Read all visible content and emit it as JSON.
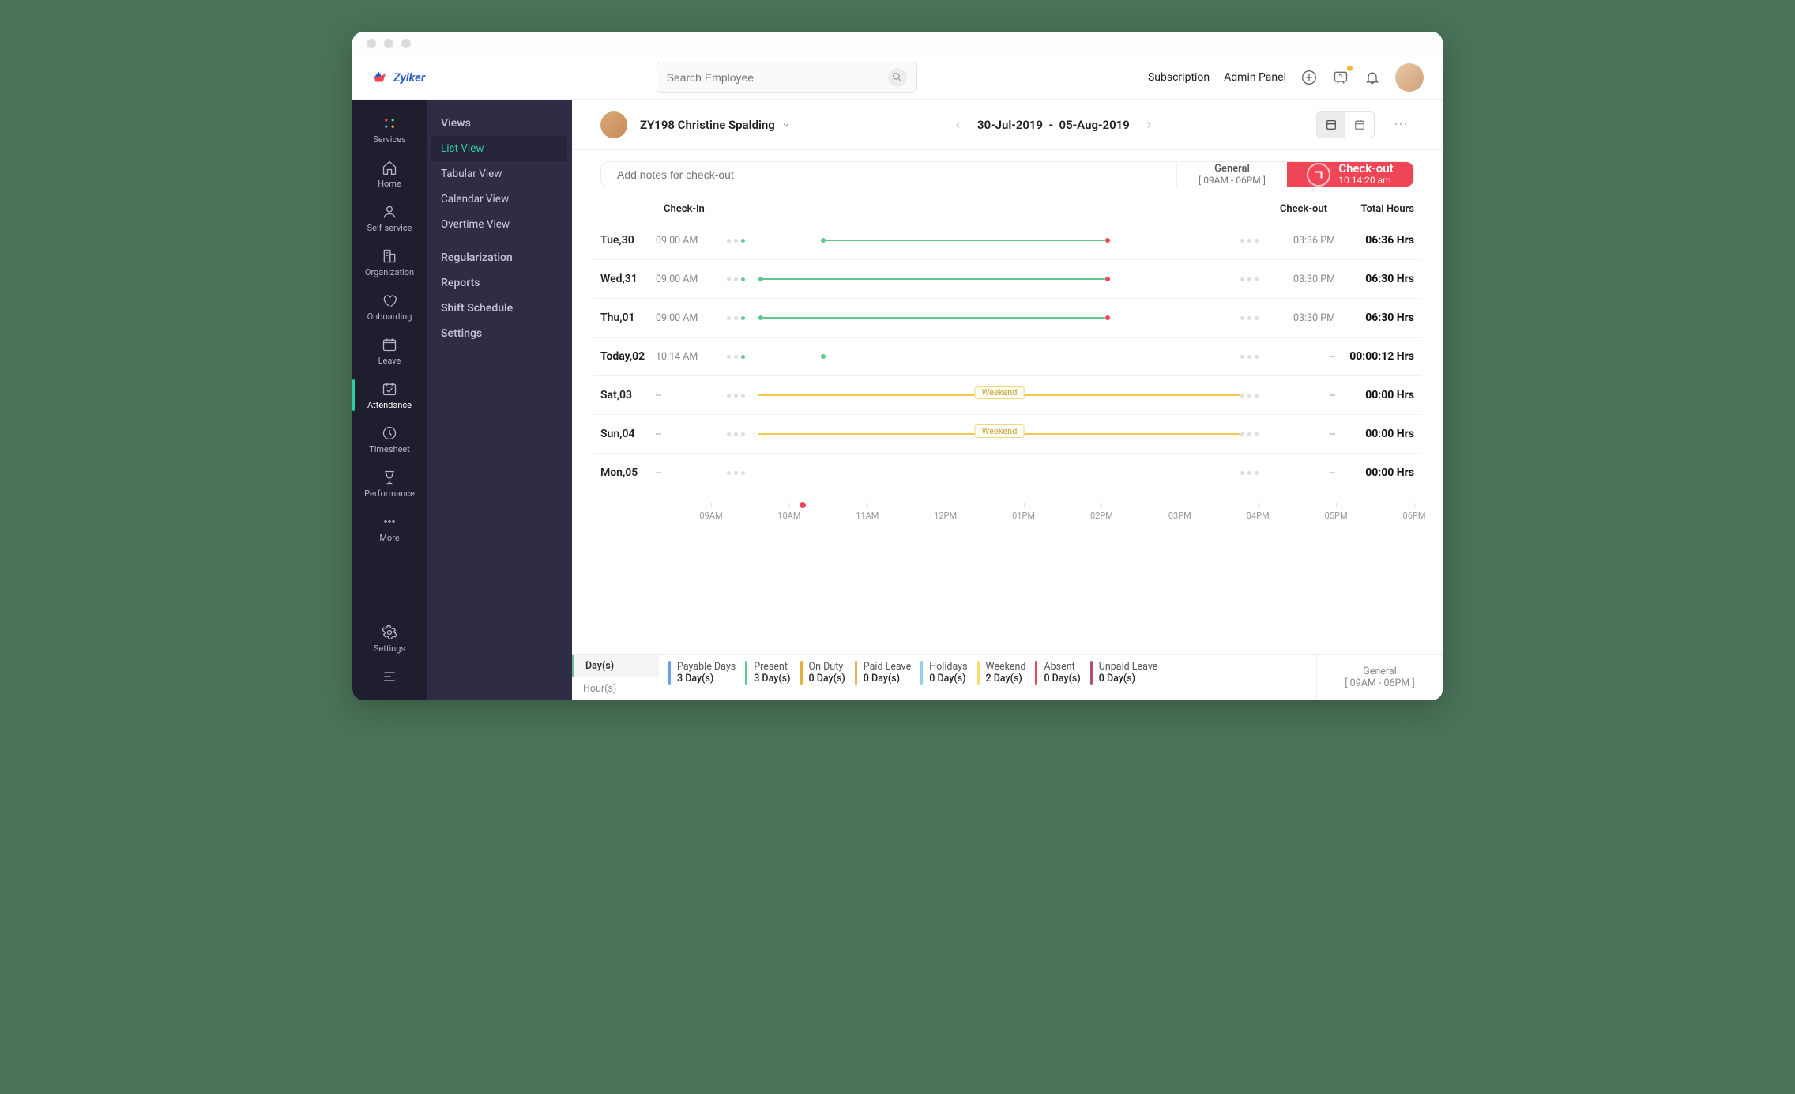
{
  "brand": "Zylker",
  "search": {
    "placeholder": "Search Employee"
  },
  "topbar": {
    "subscription": "Subscription",
    "admin_panel": "Admin Panel"
  },
  "rail": [
    {
      "id": "services",
      "label": "Services"
    },
    {
      "id": "home",
      "label": "Home"
    },
    {
      "id": "self-service",
      "label": "Self-service"
    },
    {
      "id": "organization",
      "label": "Organization"
    },
    {
      "id": "onboarding",
      "label": "Onboarding"
    },
    {
      "id": "leave",
      "label": "Leave"
    },
    {
      "id": "attendance",
      "label": "Attendance"
    },
    {
      "id": "timesheet",
      "label": "Timesheet"
    },
    {
      "id": "performance",
      "label": "Performance"
    },
    {
      "id": "more",
      "label": "More"
    },
    {
      "id": "settings",
      "label": "Settings"
    }
  ],
  "subnav": {
    "views_title": "Views",
    "items": [
      {
        "label": "List View",
        "active": true
      },
      {
        "label": "Tabular View"
      },
      {
        "label": "Calendar View"
      },
      {
        "label": "Overtime View"
      }
    ],
    "groups": [
      "Regularization",
      "Reports",
      "Shift Schedule",
      "Settings"
    ]
  },
  "employee": {
    "code_name": "ZY198 Christine Spalding"
  },
  "date_range": {
    "from": "30-Jul-2019",
    "sep": "-",
    "to": "05-Aug-2019"
  },
  "checkout": {
    "notes_placeholder": "Add notes for check-out",
    "shift_name": "General",
    "shift_time": "[ 09AM - 06PM ]",
    "button_label": "Check-out",
    "elapsed": "10:14:20 am"
  },
  "columns": {
    "checkin": "Check-in",
    "checkout": "Check-out",
    "total": "Total Hours"
  },
  "rows": [
    {
      "day": "Tue,30",
      "in": "09:00 AM",
      "out": "03:36 PM",
      "hrs": "06:36 Hrs",
      "type": "work",
      "start_pct": 13,
      "end_pct": 72
    },
    {
      "day": "Wed,31",
      "in": "09:00 AM",
      "out": "03:30 PM",
      "hrs": "06:30 Hrs",
      "type": "work",
      "start_pct": 0,
      "end_pct": 72
    },
    {
      "day": "Thu,01",
      "in": "09:00 AM",
      "out": "03:30 PM",
      "hrs": "06:30 Hrs",
      "type": "work",
      "start_pct": 0,
      "end_pct": 72
    },
    {
      "day": "Today,02",
      "in": "10:14 AM",
      "out": "--",
      "hrs": "00:00:12 Hrs",
      "type": "today",
      "start_pct": 13,
      "end_pct": 13
    },
    {
      "day": "Sat,03",
      "in": "--",
      "out": "--",
      "hrs": "00:00 Hrs",
      "type": "weekend",
      "tag": "Weekend"
    },
    {
      "day": "Sun,04",
      "in": "--",
      "out": "--",
      "hrs": "00:00 Hrs",
      "type": "weekend",
      "tag": "Weekend"
    },
    {
      "day": "Mon,05",
      "in": "--",
      "out": "--",
      "hrs": "00:00 Hrs",
      "type": "future"
    }
  ],
  "axis": {
    "ticks": [
      "09AM",
      "10AM",
      "11AM",
      "12PM",
      "01PM",
      "02PM",
      "03PM",
      "04PM",
      "05PM",
      "06PM"
    ],
    "now_pct": 13
  },
  "footer_tabs": {
    "days": "Day(s)",
    "hours": "Hour(s)"
  },
  "legend": [
    {
      "name": "Payable Days",
      "val": "3 Day(s)",
      "color": "#6e9cf2"
    },
    {
      "name": "Present",
      "val": "3 Day(s)",
      "color": "#5fc98b"
    },
    {
      "name": "On Duty",
      "val": "0 Day(s)",
      "color": "#e6b23d"
    },
    {
      "name": "Paid Leave",
      "val": "0 Day(s)",
      "color": "#f2a65a"
    },
    {
      "name": "Holidays",
      "val": "0 Day(s)",
      "color": "#8fcfe8"
    },
    {
      "name": "Weekend",
      "val": "2 Day(s)",
      "color": "#f4df6a"
    },
    {
      "name": "Absent",
      "val": "0 Day(s)",
      "color": "#f04556"
    },
    {
      "name": "Unpaid Leave",
      "val": "0 Day(s)",
      "color": "#b74c78"
    }
  ],
  "footer_shift": {
    "name": "General",
    "time": "[ 09AM - 06PM ]"
  }
}
